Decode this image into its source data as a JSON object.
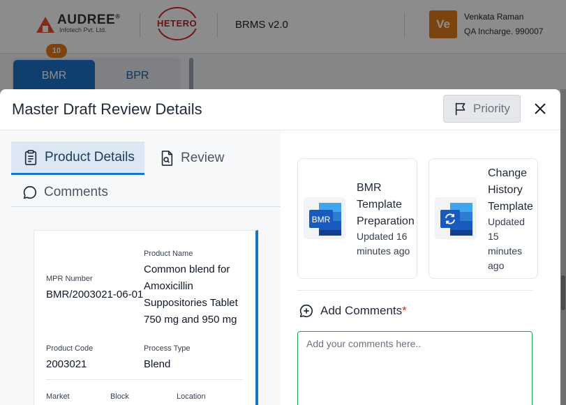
{
  "header": {
    "brand_name": "AUDREE",
    "brand_reg": "®",
    "brand_sub": "Infotech Pvt. Ltd.",
    "client_logo_text": "HETERO",
    "app_title": "BRMS v2.0",
    "user": {
      "initials": "Ve",
      "name": "Venkata Raman",
      "role": "QA Incharge. 990007"
    },
    "badge_count": "10"
  },
  "background_tabs": [
    "BMR",
    "BPR"
  ],
  "modal": {
    "title": "Master Draft Review Details",
    "priority_label": "Priority",
    "tabs": {
      "product_details": "Product Details",
      "review": "Review",
      "comments": "Comments"
    },
    "details": {
      "mpr_number_label": "MPR Number",
      "mpr_number": "BMR/2003021-06-01",
      "product_name_label": "Product Name",
      "product_name_lines": [
        "Common blend for",
        "Amoxicillin",
        "Suppositories Tablet",
        "750 mg and 950 mg"
      ],
      "product_code_label": "Product Code",
      "product_code": "2003021",
      "process_type_label": "Process Type",
      "process_type": "Blend",
      "market_label": "Market",
      "block_label": "Block",
      "location_label": "Location"
    },
    "templates": [
      {
        "icon": "bmr-document-icon",
        "icon_text": "BMR",
        "title_lines": [
          "BMR",
          "Template",
          "Preparation"
        ],
        "updated_lines": [
          "Updated 16",
          "minutes ago"
        ]
      },
      {
        "icon": "change-history-document-icon",
        "title_lines": [
          "Change",
          "History",
          "Template"
        ],
        "updated_lines": [
          "Updated",
          "15",
          "minutes",
          "ago"
        ]
      }
    ],
    "add_comments_label": "Add Comments",
    "required_mark": "*",
    "comment_placeholder": "Add your comments here.."
  },
  "colors": {
    "primary": "#1c73c8",
    "accent_orange": "#e07b1a",
    "hetero_red": "#c41e24",
    "input_border_green": "#22a447"
  }
}
